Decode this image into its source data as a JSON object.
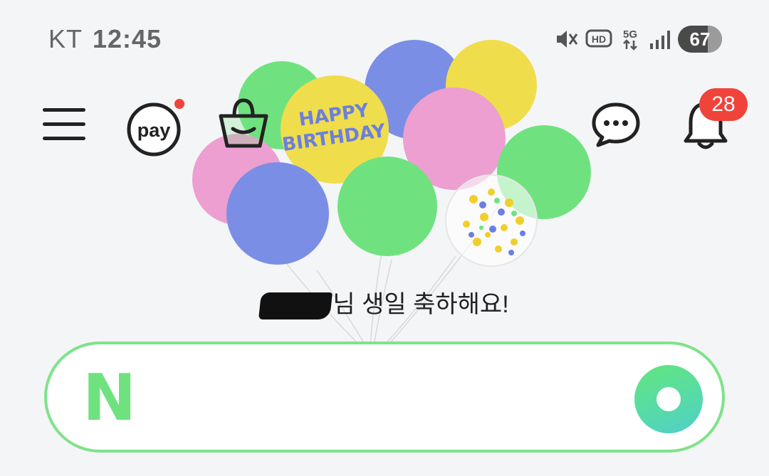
{
  "status_bar": {
    "carrier": "KT",
    "time": "12:45",
    "battery_level": "67",
    "network": "5G",
    "icons": [
      "vibrate-off-icon",
      "hd-icon",
      "5g-icon",
      "signal-icon",
      "battery-icon"
    ]
  },
  "header": {
    "menu_icon": "hamburger-menu-icon",
    "pay_label": "pay",
    "pay_has_new_dot": true,
    "shopping_icon": "shopping-bag-icon",
    "chat_icon": "chat-bubble-icon",
    "notification_icon": "bell-icon",
    "notification_count": "28"
  },
  "banner": {
    "balloon_text": [
      "HAPPY",
      "BIRTHDAY"
    ],
    "greeting": "님 생일 축하해요!"
  },
  "search": {
    "logo": "N",
    "placeholder": "",
    "assistant_icon": "green-dot-icon"
  },
  "colors": {
    "accent_green": "#6fe27f",
    "badge_red": "#f0433a",
    "background": "#f4f5f7"
  }
}
